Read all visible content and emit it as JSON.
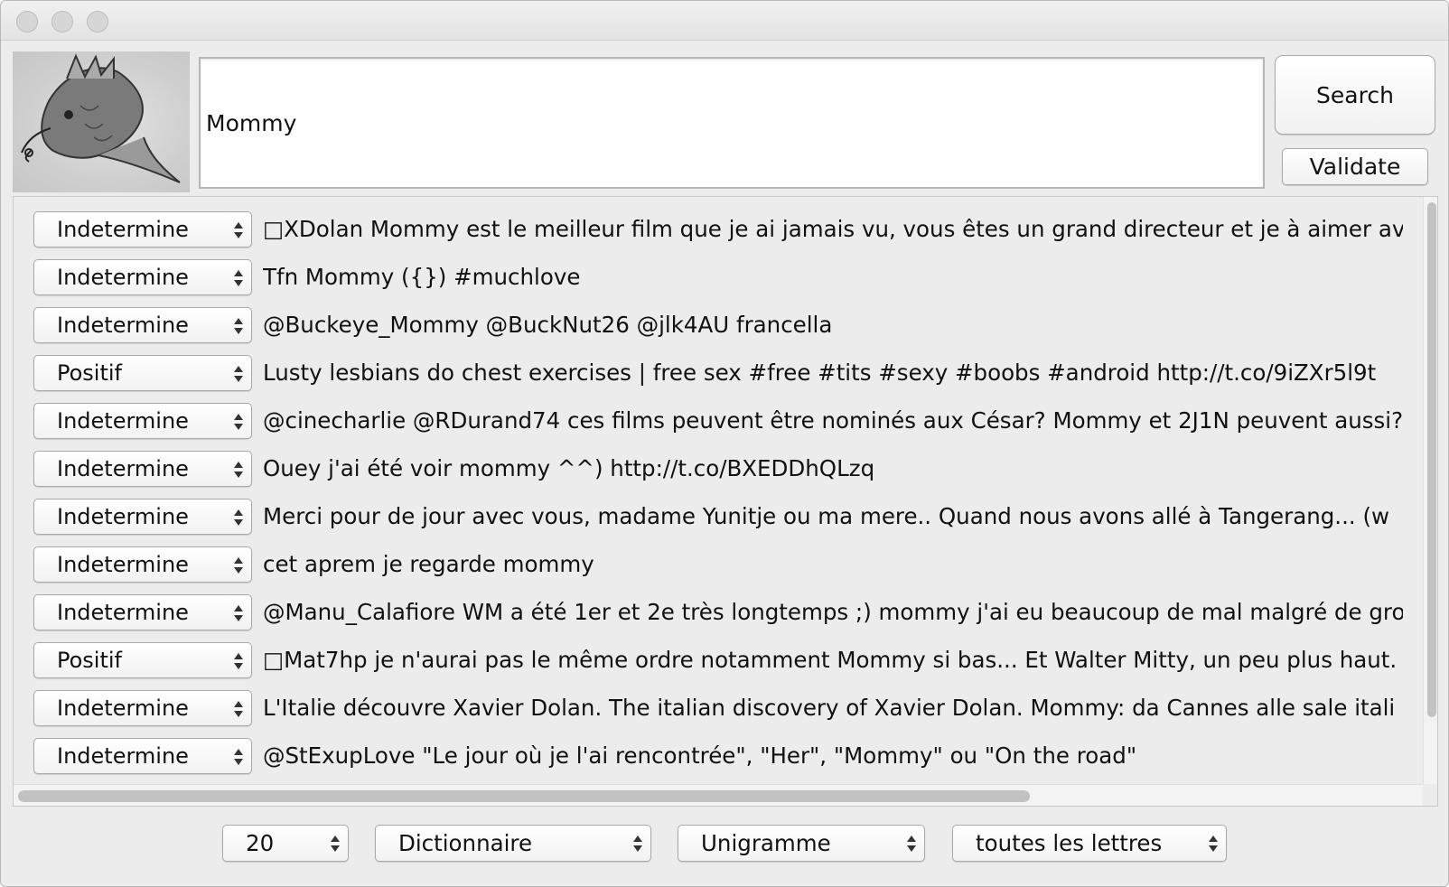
{
  "query": {
    "value": "Mommy"
  },
  "buttons": {
    "search": "Search",
    "validate": "Validate"
  },
  "results": [
    {
      "sentiment": "Indetermine",
      "text": "□XDolan Mommy est le meilleur film que je ai jamais vu, vous êtes un grand directeur et je à aimer av"
    },
    {
      "sentiment": "Indetermine",
      "text": "Tfn Mommy ({}) #muchlove"
    },
    {
      "sentiment": "Indetermine",
      "text": "@Buckeye_Mommy @BuckNut26 @jlk4AU francella"
    },
    {
      "sentiment": "Positif",
      "text": "Lusty lesbians do chest exercises | free sex  #free #tits #sexy #boobs #android http://t.co/9iZXr5l9t"
    },
    {
      "sentiment": "Indetermine",
      "text": "@cinecharlie @RDurand74 ces films peuvent être nominés aux César? Mommy et 2J1N peuvent aussi?"
    },
    {
      "sentiment": "Indetermine",
      "text": "Ouey j'ai été voir mommy ^^) http://t.co/BXEDDhQLzq"
    },
    {
      "sentiment": "Indetermine",
      "text": "Merci pour de jour avec vous, madame Yunitje ou ma mere.. Quand nous avons allé à Tangerang... (w"
    },
    {
      "sentiment": "Indetermine",
      "text": "cet aprem je regarde mommy"
    },
    {
      "sentiment": "Indetermine",
      "text": "@Manu_Calafiore WM a été 1er et 2e très longtemps ;) mommy j'ai eu beaucoup de mal malgré de gro"
    },
    {
      "sentiment": "Positif",
      "text": "□Mat7hp je n'aurai pas le même ordre notamment Mommy si bas... Et Walter Mitty, un peu plus haut."
    },
    {
      "sentiment": "Indetermine",
      "text": "L'Italie découvre Xavier Dolan. The italian discovery of Xavier Dolan. Mommy: da Cannes alle sale itali"
    },
    {
      "sentiment": "Indetermine",
      "text": "@StExupLove \"Le jour où je l'ai rencontrée\", \"Her\", \"Mommy\" ou \"On the road\""
    }
  ],
  "footer": {
    "count": "20",
    "method": "Dictionnaire",
    "ngram": "Unigramme",
    "letters": "toutes les lettres"
  },
  "logo": {
    "icon": "dragon-fish-logo"
  }
}
